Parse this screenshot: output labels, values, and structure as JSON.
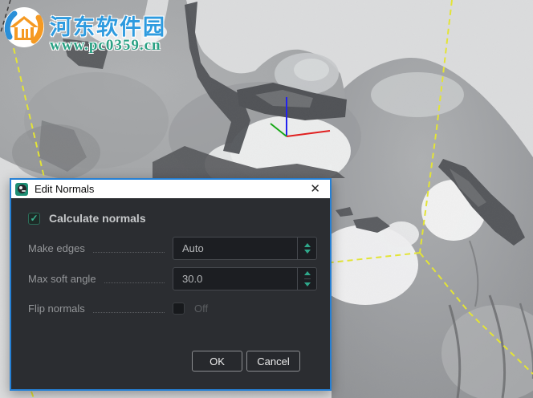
{
  "watermark": {
    "site_name": "河东软件园",
    "site_url": "www.pc0359.cn"
  },
  "dialog": {
    "title": "Edit Normals",
    "close_glyph": "✕",
    "calculate_normals": {
      "label": "Calculate normals",
      "checked": true,
      "check_glyph": "✓"
    },
    "fields": [
      {
        "label": "Make edges",
        "value": "Auto",
        "type": "dropdown"
      },
      {
        "label": "Max soft angle",
        "value": "30.0",
        "type": "spinner"
      },
      {
        "label": "Flip normals",
        "value": "Off",
        "type": "checkbox",
        "checked": false
      }
    ],
    "buttons": {
      "ok": "OK",
      "cancel": "Cancel"
    }
  },
  "colors": {
    "dialog_border": "#2580d5",
    "dialog_body": "#2b2d31",
    "accent_teal": "#2fa88b",
    "selection_dash": "#e3e436",
    "axis_x": "#e02020",
    "axis_y": "#18a818",
    "axis_z": "#2222ee"
  }
}
